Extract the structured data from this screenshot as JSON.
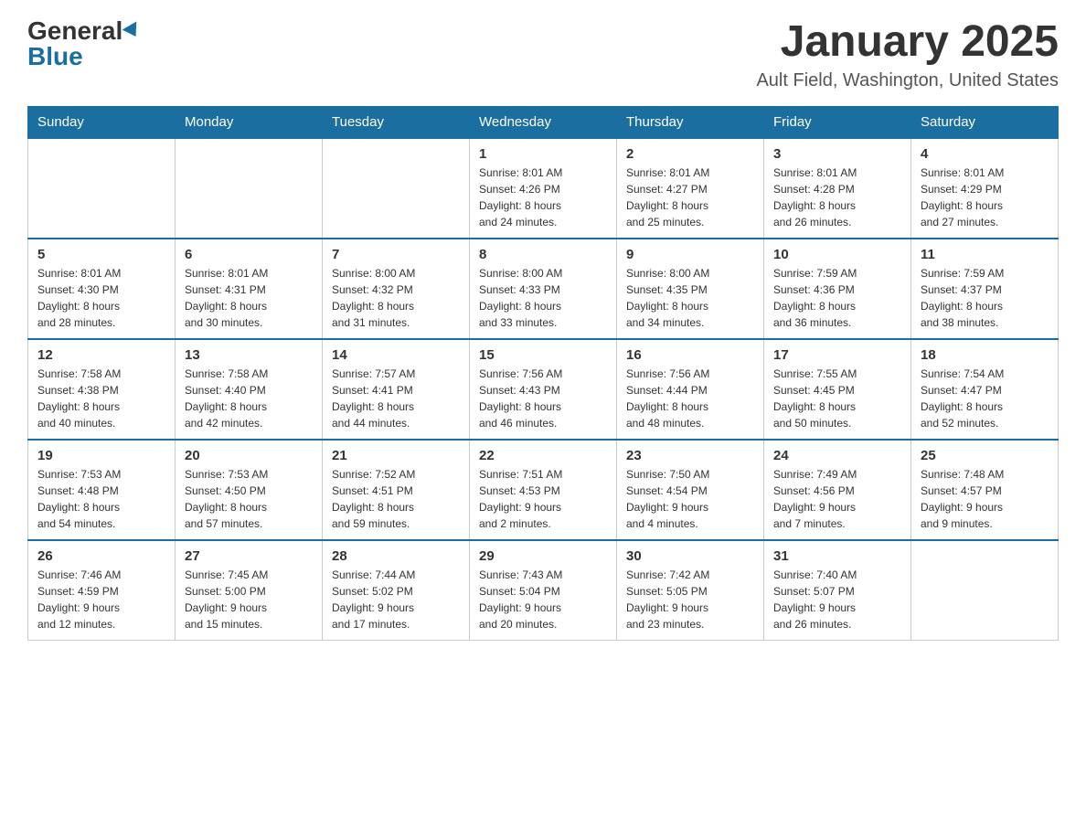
{
  "header": {
    "logo_general": "General",
    "logo_blue": "Blue",
    "title": "January 2025",
    "subtitle": "Ault Field, Washington, United States"
  },
  "days_of_week": [
    "Sunday",
    "Monday",
    "Tuesday",
    "Wednesday",
    "Thursday",
    "Friday",
    "Saturday"
  ],
  "weeks": [
    [
      {
        "day": "",
        "info": ""
      },
      {
        "day": "",
        "info": ""
      },
      {
        "day": "",
        "info": ""
      },
      {
        "day": "1",
        "info": "Sunrise: 8:01 AM\nSunset: 4:26 PM\nDaylight: 8 hours\nand 24 minutes."
      },
      {
        "day": "2",
        "info": "Sunrise: 8:01 AM\nSunset: 4:27 PM\nDaylight: 8 hours\nand 25 minutes."
      },
      {
        "day": "3",
        "info": "Sunrise: 8:01 AM\nSunset: 4:28 PM\nDaylight: 8 hours\nand 26 minutes."
      },
      {
        "day": "4",
        "info": "Sunrise: 8:01 AM\nSunset: 4:29 PM\nDaylight: 8 hours\nand 27 minutes."
      }
    ],
    [
      {
        "day": "5",
        "info": "Sunrise: 8:01 AM\nSunset: 4:30 PM\nDaylight: 8 hours\nand 28 minutes."
      },
      {
        "day": "6",
        "info": "Sunrise: 8:01 AM\nSunset: 4:31 PM\nDaylight: 8 hours\nand 30 minutes."
      },
      {
        "day": "7",
        "info": "Sunrise: 8:00 AM\nSunset: 4:32 PM\nDaylight: 8 hours\nand 31 minutes."
      },
      {
        "day": "8",
        "info": "Sunrise: 8:00 AM\nSunset: 4:33 PM\nDaylight: 8 hours\nand 33 minutes."
      },
      {
        "day": "9",
        "info": "Sunrise: 8:00 AM\nSunset: 4:35 PM\nDaylight: 8 hours\nand 34 minutes."
      },
      {
        "day": "10",
        "info": "Sunrise: 7:59 AM\nSunset: 4:36 PM\nDaylight: 8 hours\nand 36 minutes."
      },
      {
        "day": "11",
        "info": "Sunrise: 7:59 AM\nSunset: 4:37 PM\nDaylight: 8 hours\nand 38 minutes."
      }
    ],
    [
      {
        "day": "12",
        "info": "Sunrise: 7:58 AM\nSunset: 4:38 PM\nDaylight: 8 hours\nand 40 minutes."
      },
      {
        "day": "13",
        "info": "Sunrise: 7:58 AM\nSunset: 4:40 PM\nDaylight: 8 hours\nand 42 minutes."
      },
      {
        "day": "14",
        "info": "Sunrise: 7:57 AM\nSunset: 4:41 PM\nDaylight: 8 hours\nand 44 minutes."
      },
      {
        "day": "15",
        "info": "Sunrise: 7:56 AM\nSunset: 4:43 PM\nDaylight: 8 hours\nand 46 minutes."
      },
      {
        "day": "16",
        "info": "Sunrise: 7:56 AM\nSunset: 4:44 PM\nDaylight: 8 hours\nand 48 minutes."
      },
      {
        "day": "17",
        "info": "Sunrise: 7:55 AM\nSunset: 4:45 PM\nDaylight: 8 hours\nand 50 minutes."
      },
      {
        "day": "18",
        "info": "Sunrise: 7:54 AM\nSunset: 4:47 PM\nDaylight: 8 hours\nand 52 minutes."
      }
    ],
    [
      {
        "day": "19",
        "info": "Sunrise: 7:53 AM\nSunset: 4:48 PM\nDaylight: 8 hours\nand 54 minutes."
      },
      {
        "day": "20",
        "info": "Sunrise: 7:53 AM\nSunset: 4:50 PM\nDaylight: 8 hours\nand 57 minutes."
      },
      {
        "day": "21",
        "info": "Sunrise: 7:52 AM\nSunset: 4:51 PM\nDaylight: 8 hours\nand 59 minutes."
      },
      {
        "day": "22",
        "info": "Sunrise: 7:51 AM\nSunset: 4:53 PM\nDaylight: 9 hours\nand 2 minutes."
      },
      {
        "day": "23",
        "info": "Sunrise: 7:50 AM\nSunset: 4:54 PM\nDaylight: 9 hours\nand 4 minutes."
      },
      {
        "day": "24",
        "info": "Sunrise: 7:49 AM\nSunset: 4:56 PM\nDaylight: 9 hours\nand 7 minutes."
      },
      {
        "day": "25",
        "info": "Sunrise: 7:48 AM\nSunset: 4:57 PM\nDaylight: 9 hours\nand 9 minutes."
      }
    ],
    [
      {
        "day": "26",
        "info": "Sunrise: 7:46 AM\nSunset: 4:59 PM\nDaylight: 9 hours\nand 12 minutes."
      },
      {
        "day": "27",
        "info": "Sunrise: 7:45 AM\nSunset: 5:00 PM\nDaylight: 9 hours\nand 15 minutes."
      },
      {
        "day": "28",
        "info": "Sunrise: 7:44 AM\nSunset: 5:02 PM\nDaylight: 9 hours\nand 17 minutes."
      },
      {
        "day": "29",
        "info": "Sunrise: 7:43 AM\nSunset: 5:04 PM\nDaylight: 9 hours\nand 20 minutes."
      },
      {
        "day": "30",
        "info": "Sunrise: 7:42 AM\nSunset: 5:05 PM\nDaylight: 9 hours\nand 23 minutes."
      },
      {
        "day": "31",
        "info": "Sunrise: 7:40 AM\nSunset: 5:07 PM\nDaylight: 9 hours\nand 26 minutes."
      },
      {
        "day": "",
        "info": ""
      }
    ]
  ]
}
